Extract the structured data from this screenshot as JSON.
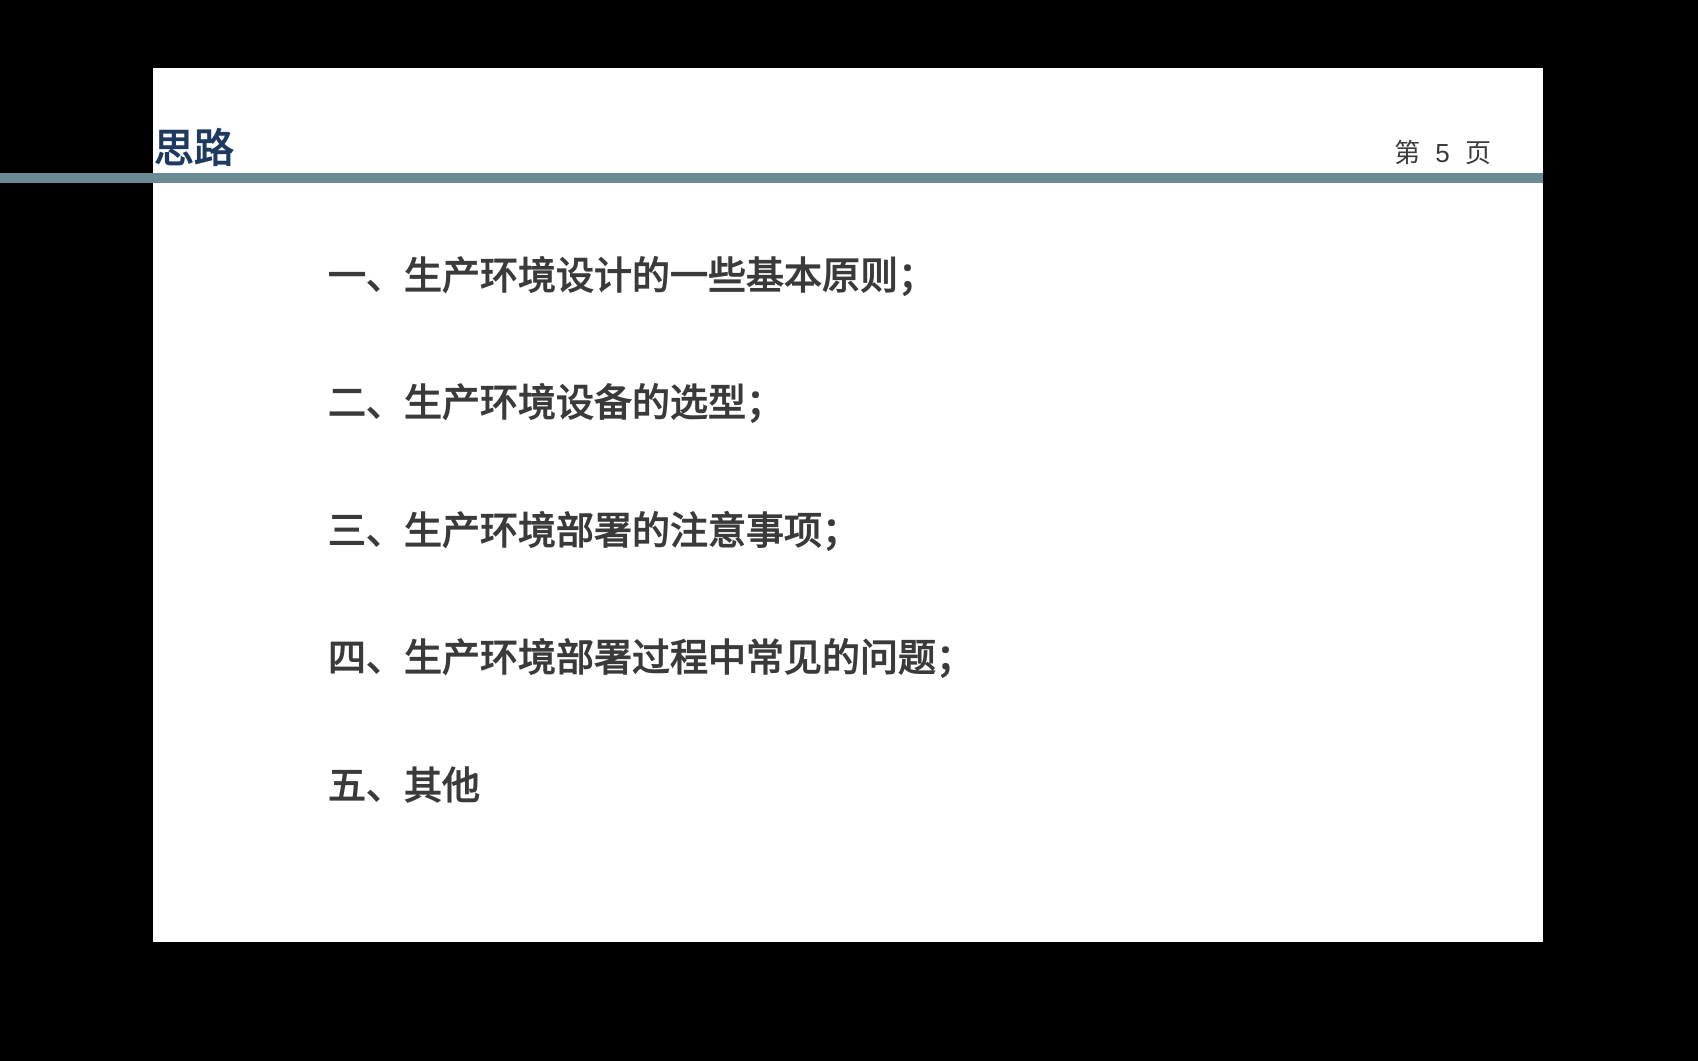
{
  "header": {
    "title": "思路",
    "page_label": "第 5 页"
  },
  "items": [
    "一、生产环境设计的一些基本原则；",
    "二、生产环境设备的选型；",
    "三、生产环境部署的注意事项；",
    "四、生产环境部署过程中常见的问题；",
    "五、其他"
  ]
}
